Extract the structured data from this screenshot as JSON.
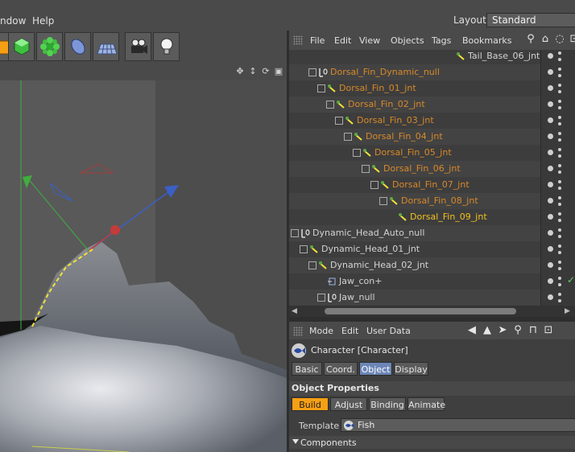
{
  "menubar": {
    "items": [
      "ndow",
      "Help"
    ],
    "layout_label": "Layout:",
    "layout_value": "Standard"
  },
  "toolbar": {
    "tools": [
      "cube-icon",
      "gear-flower-icon",
      "spline-pen-icon",
      "floor-grid-icon",
      "camera-icon",
      "light-bulb-icon"
    ]
  },
  "object_manager": {
    "menu": [
      "File",
      "Edit",
      "View",
      "Objects",
      "Tags",
      "Bookmarks"
    ],
    "rows": [
      {
        "name": "Tail_Base_06_jnt",
        "style": "gray",
        "indent": 195,
        "type": "joint",
        "tree": false
      },
      {
        "name": "Dorsal_Fin_Dynamic_null",
        "style": "orange",
        "indent": 24,
        "type": "null",
        "tree": true
      },
      {
        "name": "Dorsal_Fin_01_jnt",
        "style": "orange",
        "indent": 35,
        "type": "joint",
        "tree": true
      },
      {
        "name": "Dorsal_Fin_02_jnt",
        "style": "orange",
        "indent": 46,
        "type": "joint",
        "tree": true
      },
      {
        "name": "Dorsal_Fin_03_jnt",
        "style": "orange",
        "indent": 57,
        "type": "joint",
        "tree": true
      },
      {
        "name": "Dorsal_Fin_04_jnt",
        "style": "orange",
        "indent": 68,
        "type": "joint",
        "tree": true
      },
      {
        "name": "Dorsal_Fin_05_jnt",
        "style": "orange",
        "indent": 79,
        "type": "joint",
        "tree": true
      },
      {
        "name": "Dorsal_Fin_06_jnt",
        "style": "orange",
        "indent": 90,
        "type": "joint",
        "tree": true
      },
      {
        "name": "Dorsal_Fin_07_jnt",
        "style": "orange",
        "indent": 101,
        "type": "joint",
        "tree": true
      },
      {
        "name": "Dorsal_Fin_08_jnt",
        "style": "orange",
        "indent": 112,
        "type": "joint",
        "tree": true
      },
      {
        "name": "Dorsal_Fin_09_jnt",
        "style": "bright",
        "indent": 123,
        "type": "joint",
        "tree": false
      },
      {
        "name": "Dynamic_Head_Auto_null",
        "style": "gray",
        "indent": 2,
        "type": "null",
        "tree": true
      },
      {
        "name": "Dynamic_Head_01_jnt",
        "style": "gray",
        "indent": 13,
        "type": "joint",
        "tree": true
      },
      {
        "name": "Dynamic_Head_02_jnt",
        "style": "gray",
        "indent": 24,
        "type": "joint",
        "tree": true
      },
      {
        "name": "Jaw_con+",
        "style": "gray",
        "indent": 35,
        "type": "control",
        "tree": false
      },
      {
        "name": "Jaw_null",
        "style": "gray",
        "indent": 35,
        "type": "null",
        "tree": true
      }
    ],
    "status_check_row": 14,
    "check_mark": "✓"
  },
  "attribute_manager": {
    "menu": [
      "Mode",
      "Edit",
      "User Data"
    ],
    "object_title": "Character [Character]",
    "tabs": [
      {
        "label": "Basic",
        "active": false
      },
      {
        "label": "Coord.",
        "active": false
      },
      {
        "label": "Object",
        "active": true
      },
      {
        "label": "Display",
        "active": false
      }
    ],
    "section_title": "Object Properties",
    "subtabs": [
      {
        "label": "Build",
        "active": true
      },
      {
        "label": "Adjust",
        "active": false
      },
      {
        "label": "Binding",
        "active": false
      },
      {
        "label": "Animate",
        "active": false
      }
    ],
    "template_label": "Template",
    "template_value": "Fish",
    "components_label": "Components"
  },
  "colors": {
    "selected_orange": "#d9892a",
    "active_tab_blue": "#6c86b8",
    "active_subtab_orange": "#f59f15"
  }
}
